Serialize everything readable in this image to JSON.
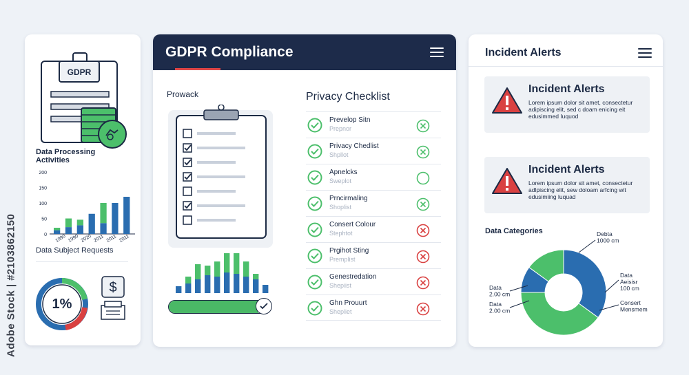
{
  "side_credit": "Adobe Stock | #2103862150",
  "left_panel": {
    "doc_badge": "GDPR",
    "processing_title": "Data Processing Activities",
    "processing_chart": {
      "type": "bar",
      "y_ticks": [
        "200",
        "150",
        "100",
        "50",
        "0"
      ],
      "x_labels": [
        "1990",
        "1990",
        "2020",
        "2011",
        "2011",
        "2011"
      ],
      "stacks": [
        {
          "blue": 12,
          "green": 8
        },
        {
          "blue": 22,
          "green": 28
        },
        {
          "blue": 28,
          "green": 18
        },
        {
          "blue": 65,
          "green": 0
        },
        {
          "blue": 35,
          "green": 65
        },
        {
          "blue": 100,
          "green": 0
        },
        {
          "blue": 120,
          "green": 0
        }
      ],
      "ylim": [
        0,
        200
      ]
    },
    "requests_title": "Data Subject Requests",
    "requests_percent": "1%",
    "money_symbol": "$"
  },
  "middle_panel": {
    "title": "GDPR Compliance",
    "prowack": "Prowack",
    "clipboard_checks": [
      false,
      true,
      true,
      true,
      false,
      true,
      false
    ],
    "mini_bars": [
      {
        "blue": 10,
        "green": 0
      },
      {
        "blue": 14,
        "green": 10
      },
      {
        "blue": 20,
        "green": 22
      },
      {
        "blue": 26,
        "green": 14
      },
      {
        "blue": 24,
        "green": 22
      },
      {
        "blue": 30,
        "green": 28
      },
      {
        "blue": 28,
        "green": 30
      },
      {
        "blue": 24,
        "green": 22
      },
      {
        "blue": 20,
        "green": 8
      },
      {
        "blue": 12,
        "green": 0
      }
    ],
    "progress_fraction": 0.88,
    "checklist_title": "Privacy Checklist",
    "checklist": [
      {
        "label": "Prevelop Sitn",
        "sub": "Prepnor",
        "status": "ok"
      },
      {
        "label": "Privacy Chedlist",
        "sub": "Shpllot",
        "status": "ok"
      },
      {
        "label": "Apnelcks",
        "sub": "Sweplot",
        "status": "pending"
      },
      {
        "label": "Prncirmaling",
        "sub": "Shoplist",
        "status": "ok"
      },
      {
        "label": "Consert Colour",
        "sub": "Stephtot",
        "status": "fail"
      },
      {
        "label": "Prgihot Sting",
        "sub": "Premplist",
        "status": "fail"
      },
      {
        "label": "Genestredation",
        "sub": "Shepiist",
        "status": "fail"
      },
      {
        "label": "Ghn Prouurt",
        "sub": "Shepliet",
        "status": "fail"
      }
    ]
  },
  "right_panel": {
    "title": "Incident Alerts",
    "alerts": [
      {
        "title": "Incident Alerts",
        "body": "Lorem ipsum dolor sit amet, consectetur adipiscing elit, sed c doam enicing eit edusimmed Iuquod"
      },
      {
        "title": "Incident Alerts",
        "body": "Lorem ipsum dolor sit amet, consectetur adlpiscing elit, sew doloam arfcing wit edusimiing luquad"
      }
    ],
    "categories_title": "Data Categories",
    "donut": {
      "segments": [
        {
          "name": "blue",
          "value": 35,
          "color": "#2a6db0"
        },
        {
          "name": "green",
          "value": 40,
          "color": "#4cbf6b"
        },
        {
          "name": "blue2",
          "value": 10,
          "color": "#2a6db0"
        },
        {
          "name": "green2",
          "value": 15,
          "color": "#4cbf6b"
        }
      ],
      "labels": {
        "top": [
          "Debta",
          "1000 cm"
        ],
        "right1": [
          "Data",
          "Aeisisr",
          "100 cm"
        ],
        "right2": [
          "Consert",
          "Mensmem"
        ],
        "left1": [
          "Data",
          "2.00 cm"
        ],
        "left2": [
          "Data",
          "2.00 cm"
        ]
      }
    }
  },
  "colors": {
    "navy": "#1d2b4a",
    "blue": "#2a6db0",
    "green": "#4cbf6b",
    "red": "#d94141",
    "accent_red": "#e04646"
  }
}
